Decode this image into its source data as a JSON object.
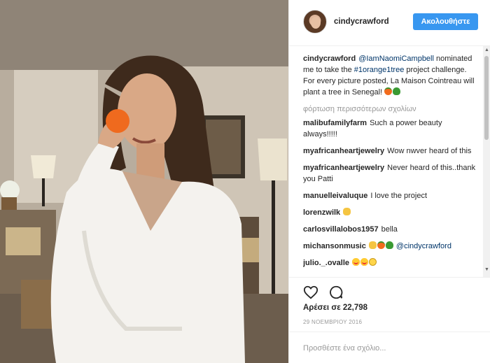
{
  "post": {
    "author": "cindycrawford",
    "follow_label": "Ακολουθήστε",
    "caption": {
      "user": "cindycrawford",
      "mention": "@IamNaomiCampbell",
      "text_1": " nominated me to take the ",
      "hashtag": "#1orange1tree",
      "text_2": " project challenge. For every picture posted, La Maison Cointreau will plant a tree in Senegal!"
    },
    "load_more": "φόρτωση περισσότερων σχολίων",
    "comments": [
      {
        "user": "malibufamilyfarm",
        "text": "Such a power beauty always!!!!!"
      },
      {
        "user": "myafricanheartjewelry",
        "text": "Wow nwver heard of this"
      },
      {
        "user": "myafricanheartjewelry",
        "text": "Never heard of this..thank you Patti"
      },
      {
        "user": "manuelleivaluque",
        "text": "I love the project"
      },
      {
        "user": "lorenzwilk",
        "text": ""
      },
      {
        "user": "carlosvillalobos1957",
        "text": "bella"
      },
      {
        "user": "michansonmusic",
        "text": "",
        "mention": "@cindycrawford"
      },
      {
        "user": "julio._.ovalle",
        "text": ""
      }
    ],
    "likes": "Αρέσει σε 22,798",
    "date": "29 ΝΟΕΜΒΡΙΟΥ 2016",
    "comment_placeholder": "Προσθέστε ένα σχόλιο..."
  },
  "icons": {
    "heart": "heart-icon",
    "comment": "comment-icon",
    "orange_emoji": "orange-emoji-icon",
    "tree_emoji": "tree-emoji-icon"
  },
  "colors": {
    "follow_button": "#3897f0",
    "link": "#003569",
    "muted": "#999999"
  }
}
